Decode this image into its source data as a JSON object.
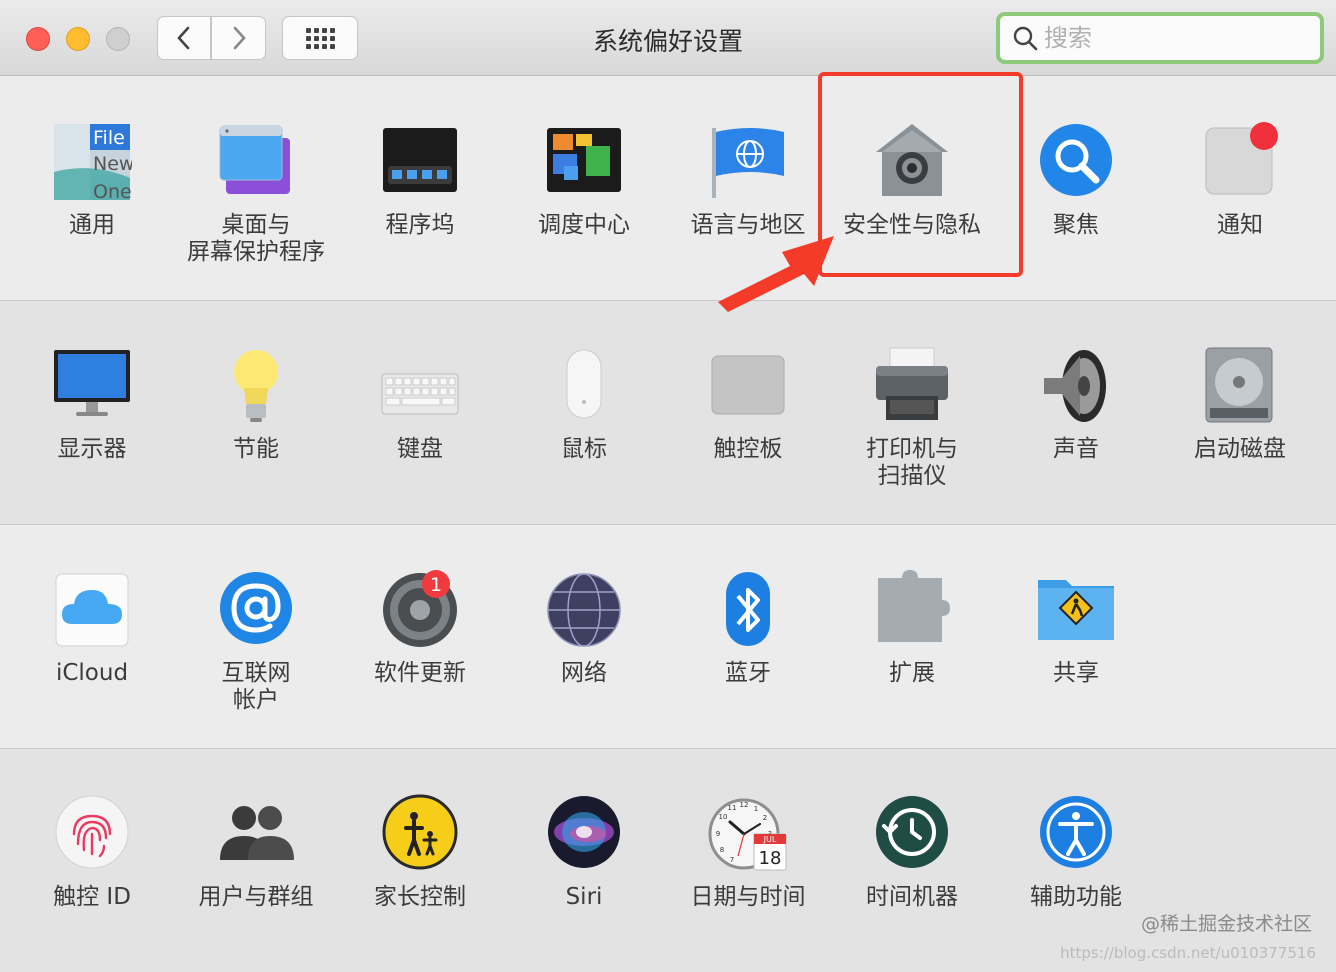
{
  "window": {
    "title": "系统偏好设置"
  },
  "search": {
    "placeholder": "搜索"
  },
  "rows": [
    [
      {
        "label": "通用",
        "icon": "general-icon"
      },
      {
        "label": "桌面与\n屏幕保护程序",
        "icon": "desktop-screensaver-icon"
      },
      {
        "label": "程序坞",
        "icon": "dock-icon"
      },
      {
        "label": "调度中心",
        "icon": "mission-control-icon"
      },
      {
        "label": "语言与地区",
        "icon": "language-region-icon"
      },
      {
        "label": "安全性与隐私",
        "icon": "security-privacy-icon"
      },
      {
        "label": "聚焦",
        "icon": "spotlight-icon"
      },
      {
        "label": "通知",
        "icon": "notifications-icon"
      }
    ],
    [
      {
        "label": "显示器",
        "icon": "displays-icon"
      },
      {
        "label": "节能",
        "icon": "energy-saver-icon"
      },
      {
        "label": "键盘",
        "icon": "keyboard-icon"
      },
      {
        "label": "鼠标",
        "icon": "mouse-icon"
      },
      {
        "label": "触控板",
        "icon": "trackpad-icon"
      },
      {
        "label": "打印机与\n扫描仪",
        "icon": "printers-scanners-icon"
      },
      {
        "label": "声音",
        "icon": "sound-icon"
      },
      {
        "label": "启动磁盘",
        "icon": "startup-disk-icon"
      }
    ],
    [
      {
        "label": "iCloud",
        "icon": "icloud-icon"
      },
      {
        "label": "互联网\n帐户",
        "icon": "internet-accounts-icon"
      },
      {
        "label": "软件更新",
        "icon": "software-update-icon"
      },
      {
        "label": "网络",
        "icon": "network-icon"
      },
      {
        "label": "蓝牙",
        "icon": "bluetooth-icon"
      },
      {
        "label": "扩展",
        "icon": "extensions-icon"
      },
      {
        "label": "共享",
        "icon": "sharing-icon"
      }
    ],
    [
      {
        "label": "触控 ID",
        "icon": "touch-id-icon"
      },
      {
        "label": "用户与群组",
        "icon": "users-groups-icon"
      },
      {
        "label": "家长控制",
        "icon": "parental-controls-icon"
      },
      {
        "label": "Siri",
        "icon": "siri-icon"
      },
      {
        "label": "日期与时间",
        "icon": "date-time-icon"
      },
      {
        "label": "时间机器",
        "icon": "time-machine-icon"
      },
      {
        "label": "辅助功能",
        "icon": "accessibility-icon"
      }
    ]
  ],
  "general_icon_text": [
    "File",
    "New",
    "One"
  ],
  "software_update_badge": "1",
  "calendar": {
    "month": "JUL",
    "day": "18"
  },
  "clock_numbers": [
    "11",
    "12",
    "1",
    "10",
    "2",
    "9",
    "3",
    "8",
    "4",
    "7",
    "5"
  ],
  "colors": {
    "highlight": "#f43b2a",
    "search_focus": "#8fc97b"
  },
  "watermark": "@稀土掘金技术社区",
  "watermark_url": "https://blog.csdn.net/u010377516"
}
